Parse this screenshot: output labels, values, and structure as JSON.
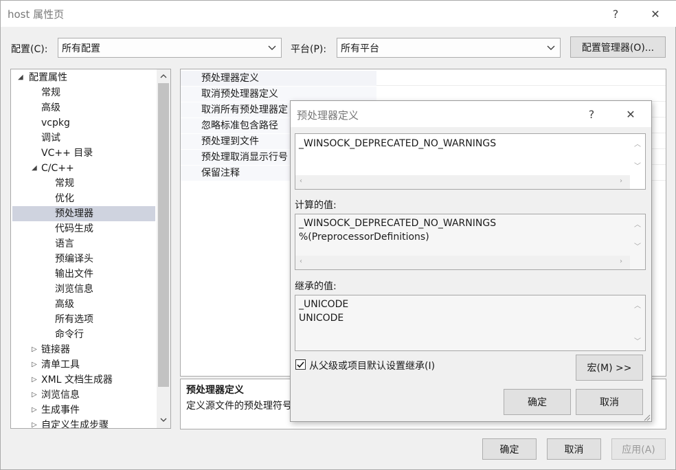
{
  "window": {
    "title": "host 属性页",
    "help_glyph": "?",
    "close_glyph": "✕"
  },
  "config_row": {
    "config_label": "配置(C):",
    "config_value": "所有配置",
    "platform_label": "平台(P):",
    "platform_value": "所有平台",
    "config_manager_button": "配置管理器(O)..."
  },
  "tree": {
    "items": [
      {
        "label": "配置属性",
        "glyph": "◢"
      },
      {
        "label": "常规"
      },
      {
        "label": "高级"
      },
      {
        "label": "vcpkg"
      },
      {
        "label": "调试"
      },
      {
        "label": "VC++ 目录"
      },
      {
        "label": "C/C++",
        "glyph": "◢"
      },
      {
        "label": "常规"
      },
      {
        "label": "优化"
      },
      {
        "label": "预处理器",
        "selected": true
      },
      {
        "label": "代码生成"
      },
      {
        "label": "语言"
      },
      {
        "label": "预编译头"
      },
      {
        "label": "输出文件"
      },
      {
        "label": "浏览信息"
      },
      {
        "label": "高级"
      },
      {
        "label": "所有选项"
      },
      {
        "label": "命令行"
      },
      {
        "label": "链接器",
        "glyph": "▷"
      },
      {
        "label": "清单工具",
        "glyph": "▷"
      },
      {
        "label": "XML 文档生成器",
        "glyph": "▷"
      },
      {
        "label": "浏览信息",
        "glyph": "▷"
      },
      {
        "label": "生成事件",
        "glyph": "▷"
      },
      {
        "label": "自定义生成步骤",
        "glyph": "▷"
      }
    ]
  },
  "properties": {
    "rows": [
      "预处理器定义",
      "取消预处理器定义",
      "取消所有预处理器定",
      "忽略标准包含路径",
      "预处理到文件",
      "预处理取消显示行号",
      "保留注释"
    ],
    "description_title": "预处理器定义",
    "description_text": "定义源文件的预处理符号"
  },
  "dialog": {
    "title": "预处理器定义",
    "help_glyph": "?",
    "close_glyph": "✕",
    "edit_value": "_WINSOCK_DEPRECATED_NO_WARNINGS",
    "evaluated_label": "计算的值:",
    "evaluated_lines": [
      "_WINSOCK_DEPRECATED_NO_WARNINGS",
      "%(PreprocessorDefinitions)"
    ],
    "inherited_label": "继承的值:",
    "inherited_lines": [
      "_UNICODE",
      "UNICODE"
    ],
    "inherit_checkbox_label": "从父级或项目默认设置继承(I)",
    "inherit_checked": true,
    "macro_button": "宏(M) >>",
    "ok_button": "确定",
    "cancel_button": "取消"
  },
  "footer": {
    "ok_button": "确定",
    "cancel_button": "取消",
    "apply_button": "应用(A)"
  },
  "colors": {
    "selection": "#cfd3df",
    "window_bg": "#f0f0f0",
    "border": "#adadad"
  }
}
